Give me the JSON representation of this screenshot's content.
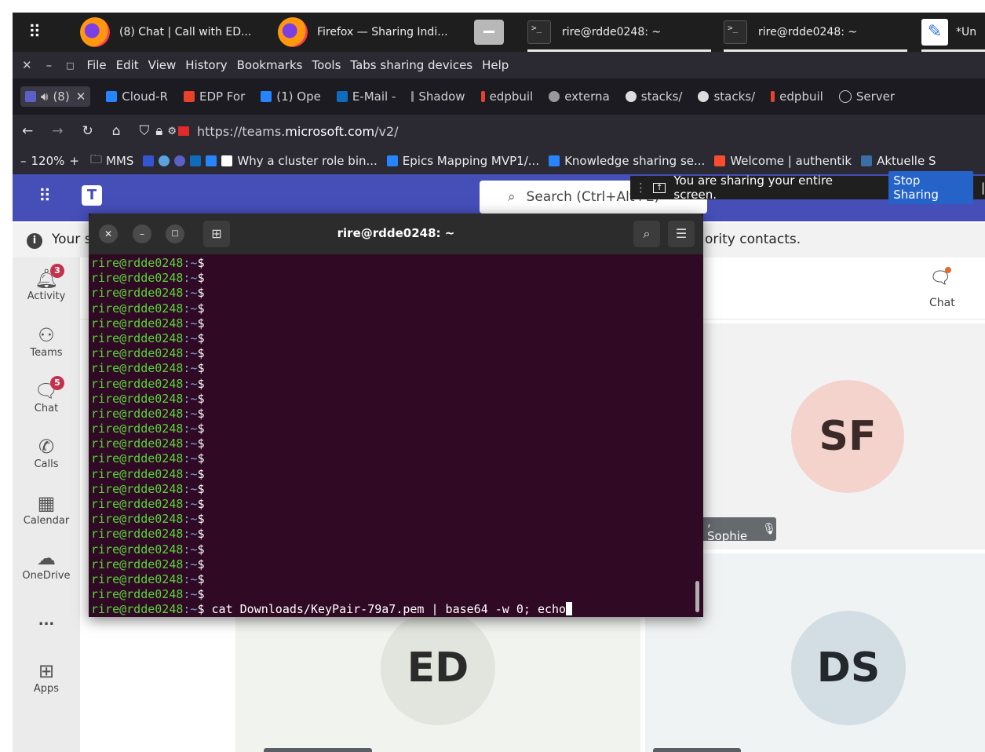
{
  "panel": {
    "tasks": [
      {
        "icon": "firefox-icon",
        "label": "(8) Chat | Call with ED..."
      },
      {
        "icon": "firefox-icon",
        "label": "Firefox — Sharing Indi..."
      },
      {
        "icon": "folder-icon",
        "label": ""
      },
      {
        "icon": "terminal-icon",
        "label": "rire@rdde0248: ~"
      },
      {
        "icon": "terminal-icon",
        "label": "rire@rdde0248: ~"
      },
      {
        "icon": "text-editor-icon",
        "label": "*Un"
      }
    ]
  },
  "menubar": {
    "items": [
      "File",
      "Edit",
      "View",
      "History",
      "Bookmarks",
      "Tools",
      "Tabs sharing devices",
      "Help"
    ]
  },
  "tabs": [
    {
      "label": "(8)",
      "color": "#5b5fc7"
    },
    {
      "label": "Cloud-R",
      "color": "#2684ff"
    },
    {
      "label": "EDP For",
      "color": "#e8412c"
    },
    {
      "label": "(1) Ope",
      "color": "#2684ff"
    },
    {
      "label": "E-Mail -",
      "color": "#0f6cbd"
    },
    {
      "label": "Shadow",
      "color": "#888888"
    },
    {
      "label": "edpbuil",
      "color": "#e8412c"
    },
    {
      "label": "externa",
      "color": "#999999"
    },
    {
      "label": "stacks/",
      "color": "#dddddd"
    },
    {
      "label": "stacks/",
      "color": "#dddddd"
    },
    {
      "label": "edpbuil",
      "color": "#e8412c"
    },
    {
      "label": "Server",
      "color": "#cccccc"
    }
  ],
  "nav": {
    "url_prefix": "https://teams.",
    "url_host": "microsoft.com",
    "url_path": "/v2/"
  },
  "bookmarks": {
    "zoom": "120%",
    "items": [
      "MMS",
      "Why a cluster role bin...",
      "Epics Mapping MVP1/...",
      "Knowledge sharing se...",
      "Welcome | authentik",
      "Aktuelle S"
    ]
  },
  "teams": {
    "search_placeholder": "Search (Ctrl+Alt+E)",
    "share_text": "You are sharing your entire screen.",
    "stop_label": "Stop Sharing",
    "info_start": "Your s",
    "info_end": "ority contacts.",
    "rail": [
      {
        "label": "Activity",
        "icon": "bell-icon",
        "badge": "3"
      },
      {
        "label": "Teams",
        "icon": "teams-icon",
        "badge": ""
      },
      {
        "label": "Chat",
        "icon": "chat-icon",
        "badge": "5"
      },
      {
        "label": "Calls",
        "icon": "phone-icon",
        "badge": ""
      },
      {
        "label": "Calendar",
        "icon": "calendar-icon",
        "badge": ""
      },
      {
        "label": "OneDrive",
        "icon": "cloud-icon",
        "badge": ""
      },
      {
        "label": "...",
        "icon": "more-icon",
        "badge": ""
      },
      {
        "label": "Apps",
        "icon": "plus-square-icon",
        "badge": ""
      }
    ],
    "chat_corner": "Chat",
    "participants": [
      {
        "initials": "SF",
        "bg": "#f4d3cc",
        "fg": "#3b2a27"
      },
      {
        "initials": "ED",
        "bg": "#e2e5dd",
        "fg": "#2b2b2b"
      },
      {
        "initials": "DS",
        "bg": "#d3dee4",
        "fg": "#22282c"
      }
    ],
    "name_chip": ", Sophie"
  },
  "terminal": {
    "title": "rire@rdde0248: ~",
    "prompt_user": "rire@rdde0248",
    "prompt_tail": ":~$",
    "empty_lines": 23,
    "command": " cat Downloads/KeyPair-79a7.pem | base64 -w 0; echo"
  }
}
